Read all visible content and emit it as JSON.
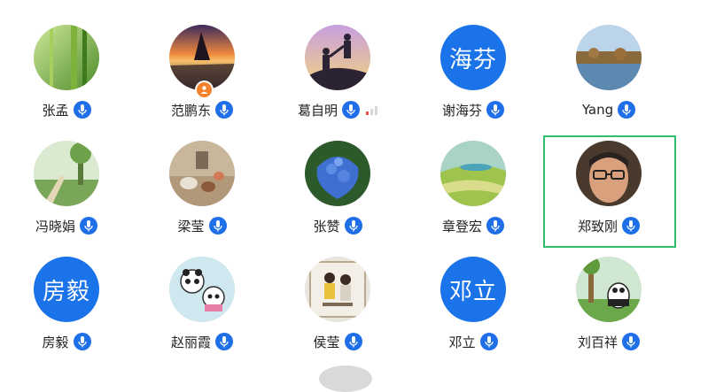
{
  "participants": [
    {
      "name": "张孟",
      "avatar": "bamboo-photo",
      "mic": "speaker-icon"
    },
    {
      "name": "范鹏东",
      "avatar": "sunset-rock-photo",
      "mic": "speaker-icon",
      "host": true
    },
    {
      "name": "葛自明",
      "avatar": "climbers-silhouette-photo",
      "mic": "speaker-icon",
      "signal": "weak"
    },
    {
      "name": "谢海芬",
      "avatar_text": "海芬",
      "avatar_color": "#1a73e8",
      "mic": "speaker-icon"
    },
    {
      "name": "Yang",
      "avatar": "lake-landscape-photo",
      "mic": "speaker-icon"
    },
    {
      "name": "冯晓娟",
      "avatar": "garden-path-photo",
      "mic": "speaker-icon"
    },
    {
      "name": "梁莹",
      "avatar": "shells-photo",
      "mic": "speaker-icon"
    },
    {
      "name": "张赞",
      "avatar": "hydrangea-photo",
      "mic": "speaker-icon"
    },
    {
      "name": "章登宏",
      "avatar": "golf-course-photo",
      "mic": "speaker-icon"
    },
    {
      "name": "郑致刚",
      "avatar": "face-with-glasses-photo",
      "mic": "speaker-icon",
      "active": true
    },
    {
      "name": "房毅",
      "avatar_text": "房毅",
      "avatar_color": "#1a73e8",
      "mic": "speaker-icon"
    },
    {
      "name": "赵丽霞",
      "avatar": "panda-cartoon-photo",
      "mic": "speaker-icon"
    },
    {
      "name": "侯莹",
      "avatar": "kids-photo",
      "mic": "speaker-icon"
    },
    {
      "name": "邓立",
      "avatar_text": "邓立",
      "avatar_color": "#1a73e8",
      "mic": "speaker-icon"
    },
    {
      "name": "刘百祥",
      "avatar": "panda-garden-photo",
      "mic": "speaker-icon"
    }
  ],
  "colors": {
    "accent": "#1f6fe8",
    "active_border": "#2fbf6a",
    "host_badge": "#f5822b"
  }
}
